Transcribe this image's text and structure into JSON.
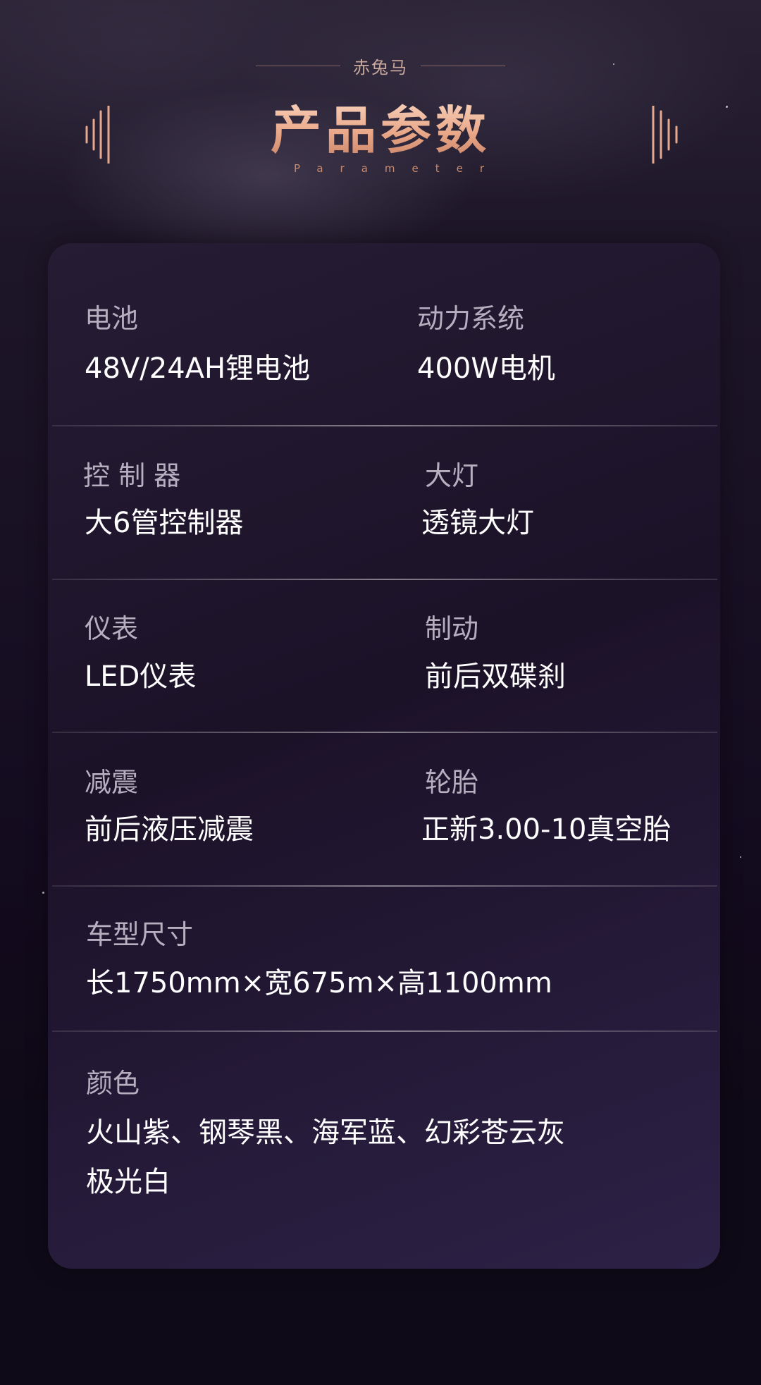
{
  "header": {
    "brand": "赤兔马",
    "title": "产品参数",
    "subtitle": "Parameter"
  },
  "specs": {
    "battery": {
      "label": "电池",
      "value": "48V/24AH锂电池"
    },
    "power": {
      "label": "动力系统",
      "value": "400W电机"
    },
    "controller": {
      "label": "控 制 器",
      "value": "大6管控制器"
    },
    "headlight": {
      "label": "大灯",
      "value": "透镜大灯"
    },
    "meter": {
      "label": "仪表",
      "value": "LED仪表"
    },
    "brake": {
      "label": "制动",
      "value": "前后双碟刹"
    },
    "suspension": {
      "label": "减震",
      "value": "前后液压减震"
    },
    "tire": {
      "label": "轮胎",
      "value": "正新3.00-10真空胎"
    },
    "dimensions": {
      "label": "车型尺寸",
      "value": "长1750mm×宽675m×高1100mm"
    },
    "color": {
      "label": "颜色",
      "value_line1": "火山紫、钢琴黑、海军蓝、幻彩苍云灰",
      "value_line2": "极光白"
    }
  },
  "colors": {
    "accent": "#e9a787",
    "label": "#b7afc0",
    "value": "#ffffff",
    "card": "#241a34"
  }
}
